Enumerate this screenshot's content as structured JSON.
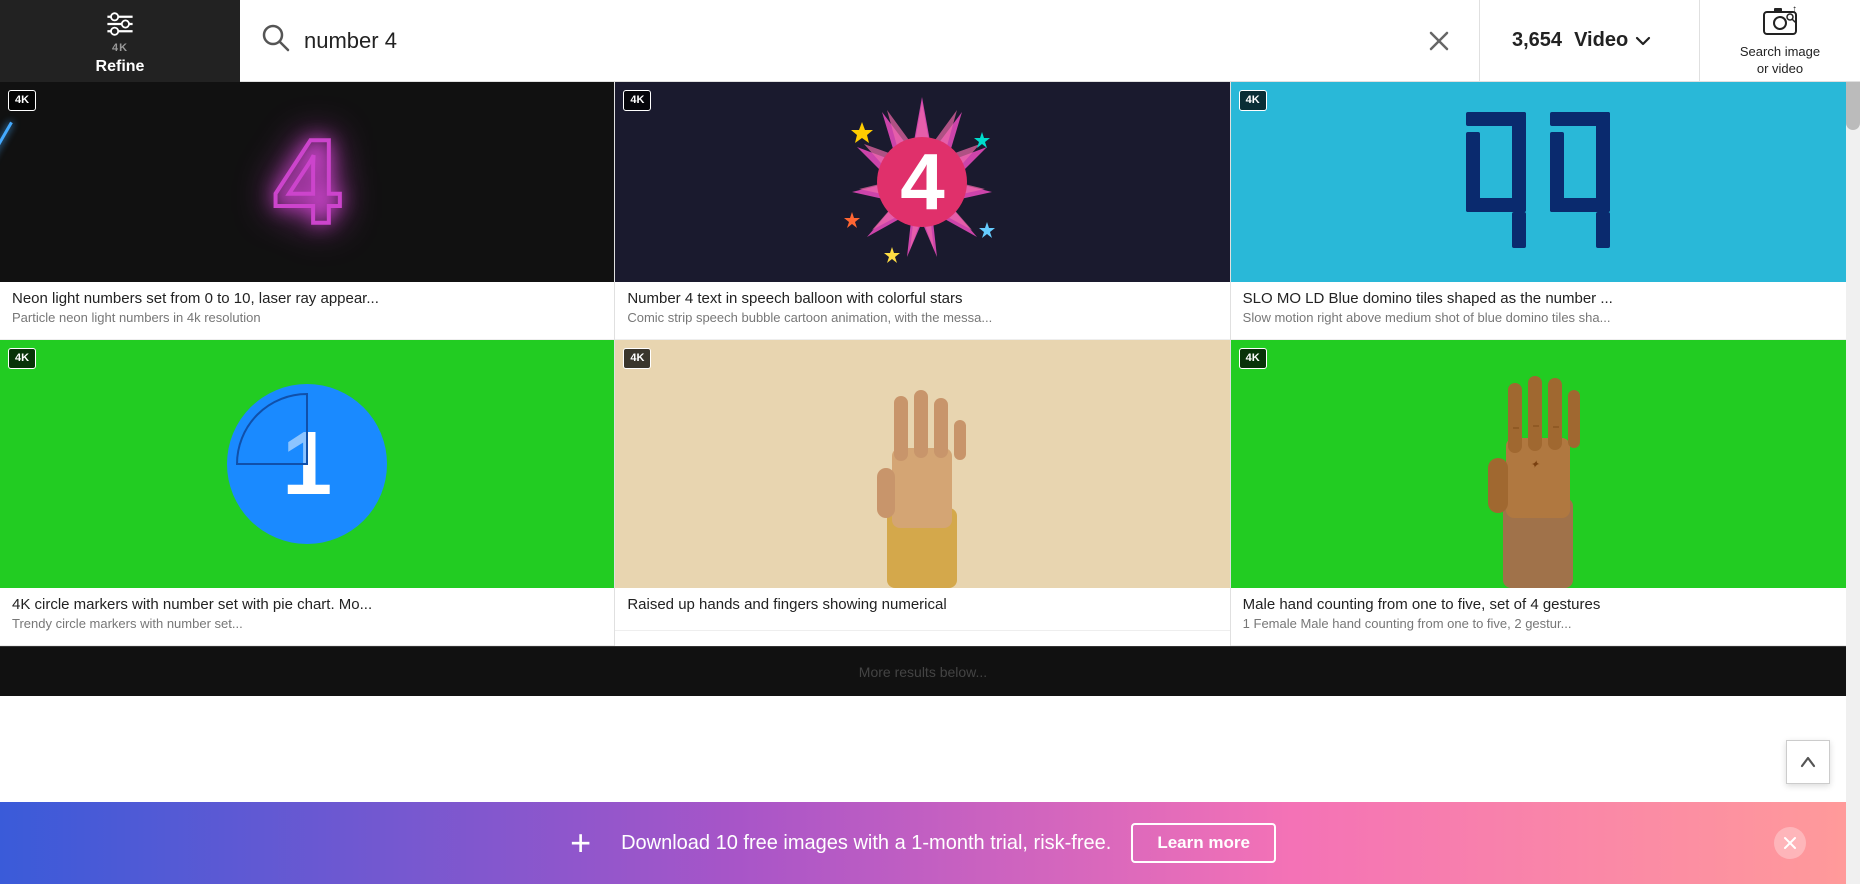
{
  "header": {
    "refine_label": "Refine",
    "search_placeholder": "number 4",
    "results_count": "3,654",
    "video_label": "Video",
    "search_image_label": "Search image\nor video",
    "clear_label": "×"
  },
  "grid": {
    "items": [
      {
        "id": 1,
        "badge": "4K",
        "title": "Neon light numbers set from 0 to 10, laser ray appear...",
        "subtitle": "Particle neon light numbers in 4k resolution",
        "has_badge": true
      },
      {
        "id": 2,
        "badge": "4K",
        "title": "Number 4 text in speech balloon with colorful stars",
        "subtitle": "Comic strip speech bubble cartoon animation, with the messa...",
        "has_badge": true
      },
      {
        "id": 3,
        "badge": "4K",
        "title": "SLO MO LD Blue domino tiles shaped as the number ...",
        "subtitle": "Slow motion right above medium shot of blue domino tiles sha...",
        "has_badge": true
      },
      {
        "id": 4,
        "badge": "4K",
        "title": "4K circle markers with number set with pie chart. Mo...",
        "subtitle": "Trendy circle markers with number set...",
        "has_badge": true
      },
      {
        "id": 5,
        "badge": "4K",
        "title": "Raised up hands and fingers showing numerical",
        "subtitle": "",
        "has_badge": true
      },
      {
        "id": 6,
        "badge": "4K",
        "title": "Male hand counting from one to five, set of 4 gestures",
        "subtitle": "1 Female Male hand counting from one to five, 2 gestur...",
        "has_badge": true
      }
    ]
  },
  "banner": {
    "text": "Download 10 free images with a 1-month trial, risk-free.",
    "learn_more": "Learn more",
    "plus_symbol": "+"
  }
}
